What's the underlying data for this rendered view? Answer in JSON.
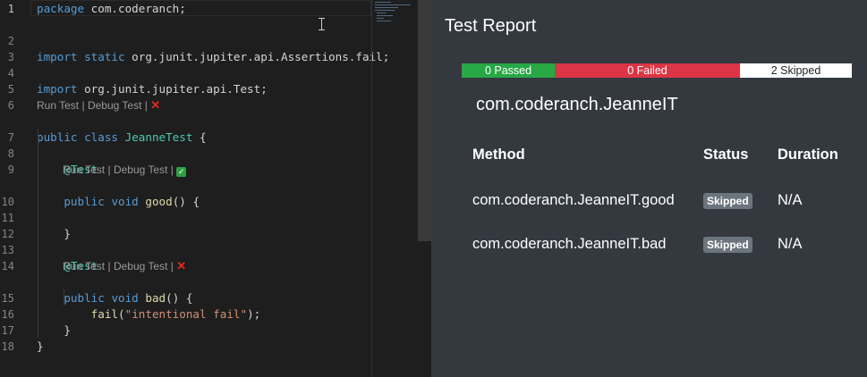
{
  "editor": {
    "lines": [
      {
        "num": "1",
        "segments": [
          {
            "t": "package",
            "c": "kw"
          },
          {
            "t": " com.coderanch;",
            "c": ""
          }
        ]
      },
      {
        "num": "2",
        "segments": []
      },
      {
        "num": "3",
        "segments": [
          {
            "t": "import",
            "c": "kw"
          },
          {
            "t": " ",
            "c": ""
          },
          {
            "t": "static",
            "c": "kw"
          },
          {
            "t": " org.junit.jupiter.api.Assertions.fail;",
            "c": ""
          }
        ]
      },
      {
        "num": "4",
        "segments": []
      },
      {
        "num": "5",
        "segments": [
          {
            "t": "import",
            "c": "kw"
          },
          {
            "t": " org.junit.jupiter.api.Test;",
            "c": ""
          }
        ]
      },
      {
        "num": "6",
        "segments": []
      },
      {
        "num": "7",
        "segments": [
          {
            "t": "public",
            "c": "kw"
          },
          {
            "t": " ",
            "c": ""
          },
          {
            "t": "class",
            "c": "kw"
          },
          {
            "t": " ",
            "c": ""
          },
          {
            "t": "JeanneTest",
            "c": "cls"
          },
          {
            "t": " {",
            "c": ""
          }
        ]
      },
      {
        "num": "8",
        "segments": []
      },
      {
        "num": "9",
        "segments": [
          {
            "t": "    ",
            "c": ""
          },
          {
            "t": "@Test",
            "c": "ann"
          }
        ]
      },
      {
        "num": "10",
        "segments": [
          {
            "t": "    ",
            "c": ""
          },
          {
            "t": "public",
            "c": "kw"
          },
          {
            "t": " ",
            "c": ""
          },
          {
            "t": "void",
            "c": "kw"
          },
          {
            "t": " ",
            "c": ""
          },
          {
            "t": "good",
            "c": "fn"
          },
          {
            "t": "() {",
            "c": ""
          }
        ]
      },
      {
        "num": "11",
        "segments": []
      },
      {
        "num": "12",
        "segments": [
          {
            "t": "    }",
            "c": ""
          }
        ]
      },
      {
        "num": "13",
        "segments": []
      },
      {
        "num": "14",
        "segments": [
          {
            "t": "    ",
            "c": ""
          },
          {
            "t": "@Test",
            "c": "ann"
          }
        ]
      },
      {
        "num": "15",
        "segments": [
          {
            "t": "    ",
            "c": ""
          },
          {
            "t": "public",
            "c": "kw"
          },
          {
            "t": " ",
            "c": ""
          },
          {
            "t": "void",
            "c": "kw"
          },
          {
            "t": " ",
            "c": ""
          },
          {
            "t": "bad",
            "c": "fn"
          },
          {
            "t": "() {",
            "c": ""
          }
        ]
      },
      {
        "num": "16",
        "segments": [
          {
            "t": "        ",
            "c": ""
          },
          {
            "t": "fail",
            "c": "fn"
          },
          {
            "t": "(",
            "c": ""
          },
          {
            "t": "\"intentional fail\"",
            "c": "str"
          },
          {
            "t": ");",
            "c": ""
          }
        ]
      },
      {
        "num": "17",
        "segments": [
          {
            "t": "    }",
            "c": ""
          }
        ]
      },
      {
        "num": "18",
        "segments": [
          {
            "t": "}",
            "c": ""
          }
        ]
      }
    ],
    "codelens": [
      {
        "run": "Run Test",
        "sep": "|",
        "debug": "Debug Test",
        "sep2": "|",
        "status": "fail",
        "symbol": "✕"
      },
      {
        "run": "Run Test",
        "sep": "|",
        "debug": "Debug Test",
        "sep2": "|",
        "status": "pass",
        "symbol": "✓"
      },
      {
        "run": "Run Test",
        "sep": "|",
        "debug": "Debug Test",
        "sep2": "|",
        "status": "fail",
        "symbol": "✕"
      }
    ]
  },
  "report": {
    "title": "Test Report",
    "summary": {
      "passed": "0 Passed",
      "failed": "0 Failed",
      "skipped": "2 Skipped"
    },
    "suite": "com.coderanch.JeanneIT",
    "headers": {
      "method": "Method",
      "status": "Status",
      "duration": "Duration"
    },
    "rows": [
      {
        "method": "com.coderanch.JeanneIT.good",
        "status": "Skipped",
        "duration": "N/A"
      },
      {
        "method": "com.coderanch.JeanneIT.bad",
        "status": "Skipped",
        "duration": "N/A"
      }
    ]
  }
}
